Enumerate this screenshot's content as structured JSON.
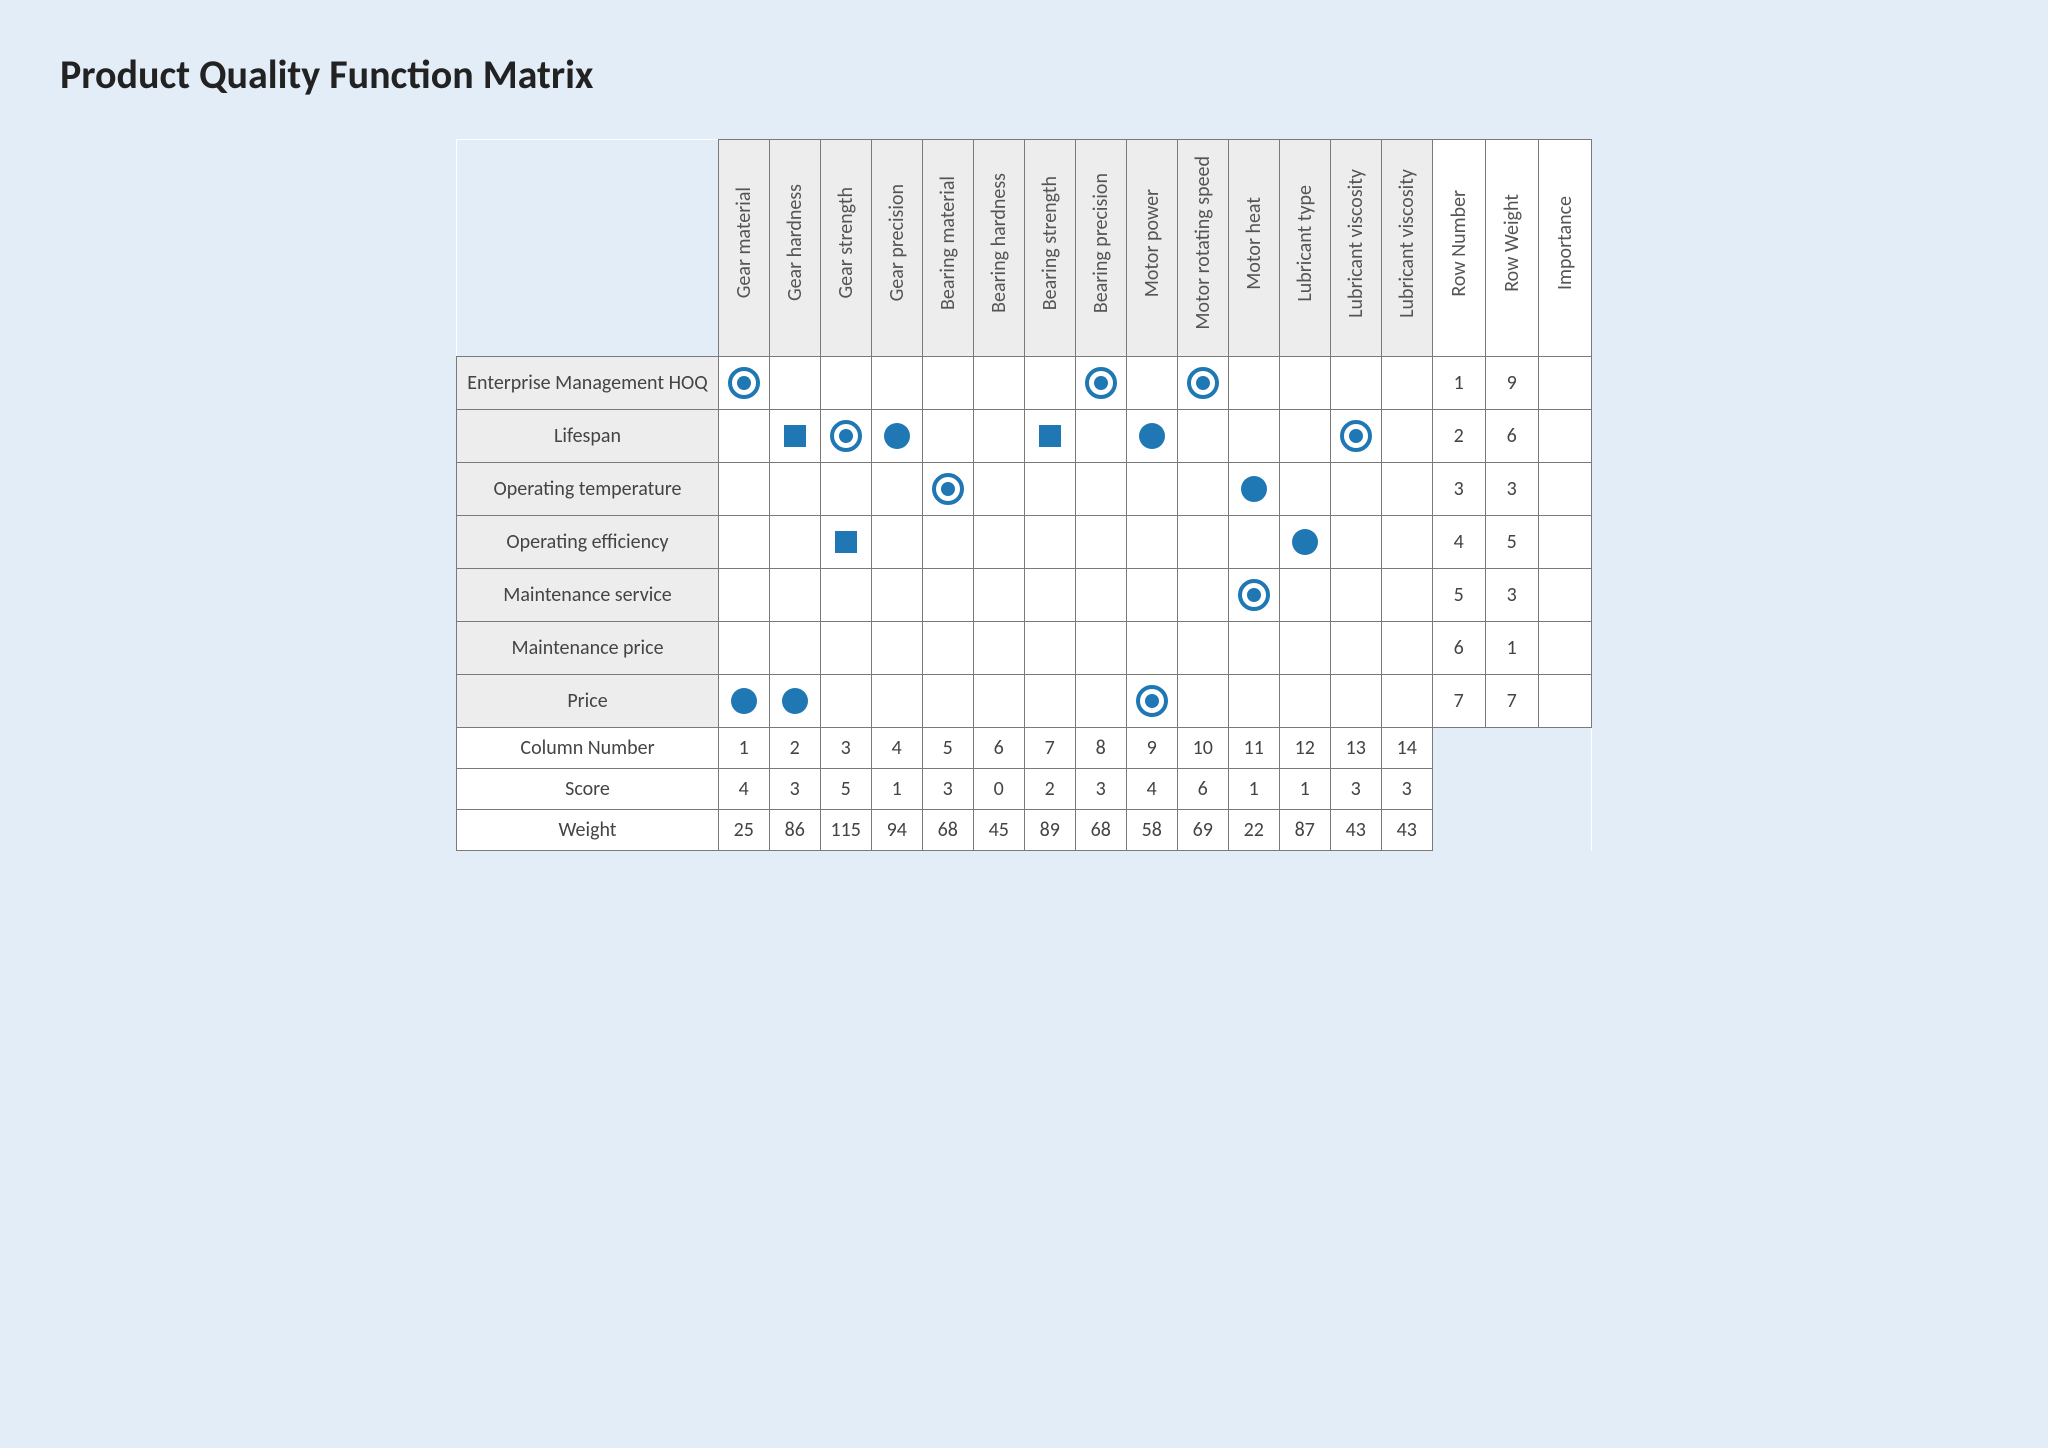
{
  "title": "Product Quality Function Matrix",
  "columns": [
    "Gear material",
    "Gear hardness",
    "Gear strength",
    "Gear precision",
    "Bearing material",
    "Bearing hardness",
    "Bearing strength",
    "Bearing precision",
    "Motor power",
    "Motor rotating speed",
    "Motor heat",
    "Lubricant type",
    "Lubricant viscosity",
    "Lubricant viscosity"
  ],
  "meta_columns": [
    "Row Number",
    "Row Weight",
    "Importance"
  ],
  "rows": [
    {
      "label": "Enterprise Management HOQ",
      "number": 1,
      "weight": 9,
      "importance": "",
      "cells": [
        "target",
        "",
        "",
        "",
        "",
        "",
        "",
        "target",
        "",
        "target",
        "",
        "",
        "",
        ""
      ]
    },
    {
      "label": "Lifespan",
      "number": 2,
      "weight": 6,
      "importance": "",
      "cells": [
        "",
        "square",
        "target",
        "circle",
        "",
        "",
        "square",
        "",
        "circle",
        "",
        "",
        "",
        "target",
        ""
      ]
    },
    {
      "label": "Operating temperature",
      "number": 3,
      "weight": 3,
      "importance": "",
      "cells": [
        "",
        "",
        "",
        "",
        "target",
        "",
        "",
        "",
        "",
        "",
        "circle",
        "",
        "",
        ""
      ]
    },
    {
      "label": "Operating efficiency",
      "number": 4,
      "weight": 5,
      "importance": "",
      "cells": [
        "",
        "",
        "square",
        "",
        "",
        "",
        "",
        "",
        "",
        "",
        "",
        "circle",
        "",
        ""
      ]
    },
    {
      "label": "Maintenance service",
      "number": 5,
      "weight": 3,
      "importance": "",
      "cells": [
        "",
        "",
        "",
        "",
        "",
        "",
        "",
        "",
        "",
        "",
        "target",
        "",
        "",
        ""
      ]
    },
    {
      "label": "Maintenance price",
      "number": 6,
      "weight": 1,
      "importance": "",
      "cells": [
        "",
        "",
        "",
        "",
        "",
        "",
        "",
        "",
        "",
        "",
        "",
        "",
        "",
        ""
      ]
    },
    {
      "label": "Price",
      "number": 7,
      "weight": 7,
      "importance": "",
      "cells": [
        "circle",
        "circle",
        "",
        "",
        "",
        "",
        "",
        "",
        "target",
        "",
        "",
        "",
        "",
        ""
      ]
    }
  ],
  "footer": {
    "col_number_label": "Column Number",
    "score_label": "Score",
    "weight_label": "Weight",
    "col_number": [
      1,
      2,
      3,
      4,
      5,
      6,
      7,
      8,
      9,
      10,
      11,
      12,
      13,
      14
    ],
    "score": [
      4,
      3,
      5,
      1,
      3,
      0,
      2,
      3,
      4,
      6,
      1,
      1,
      3,
      3
    ],
    "weight": [
      25,
      86,
      115,
      94,
      68,
      45,
      89,
      68,
      58,
      69,
      22,
      87,
      43,
      43
    ]
  },
  "symbols": {
    "target": "strong-relation-target-icon",
    "circle": "medium-relation-circle-icon",
    "square": "weak-relation-square-icon"
  },
  "accent": "#1f77b4"
}
